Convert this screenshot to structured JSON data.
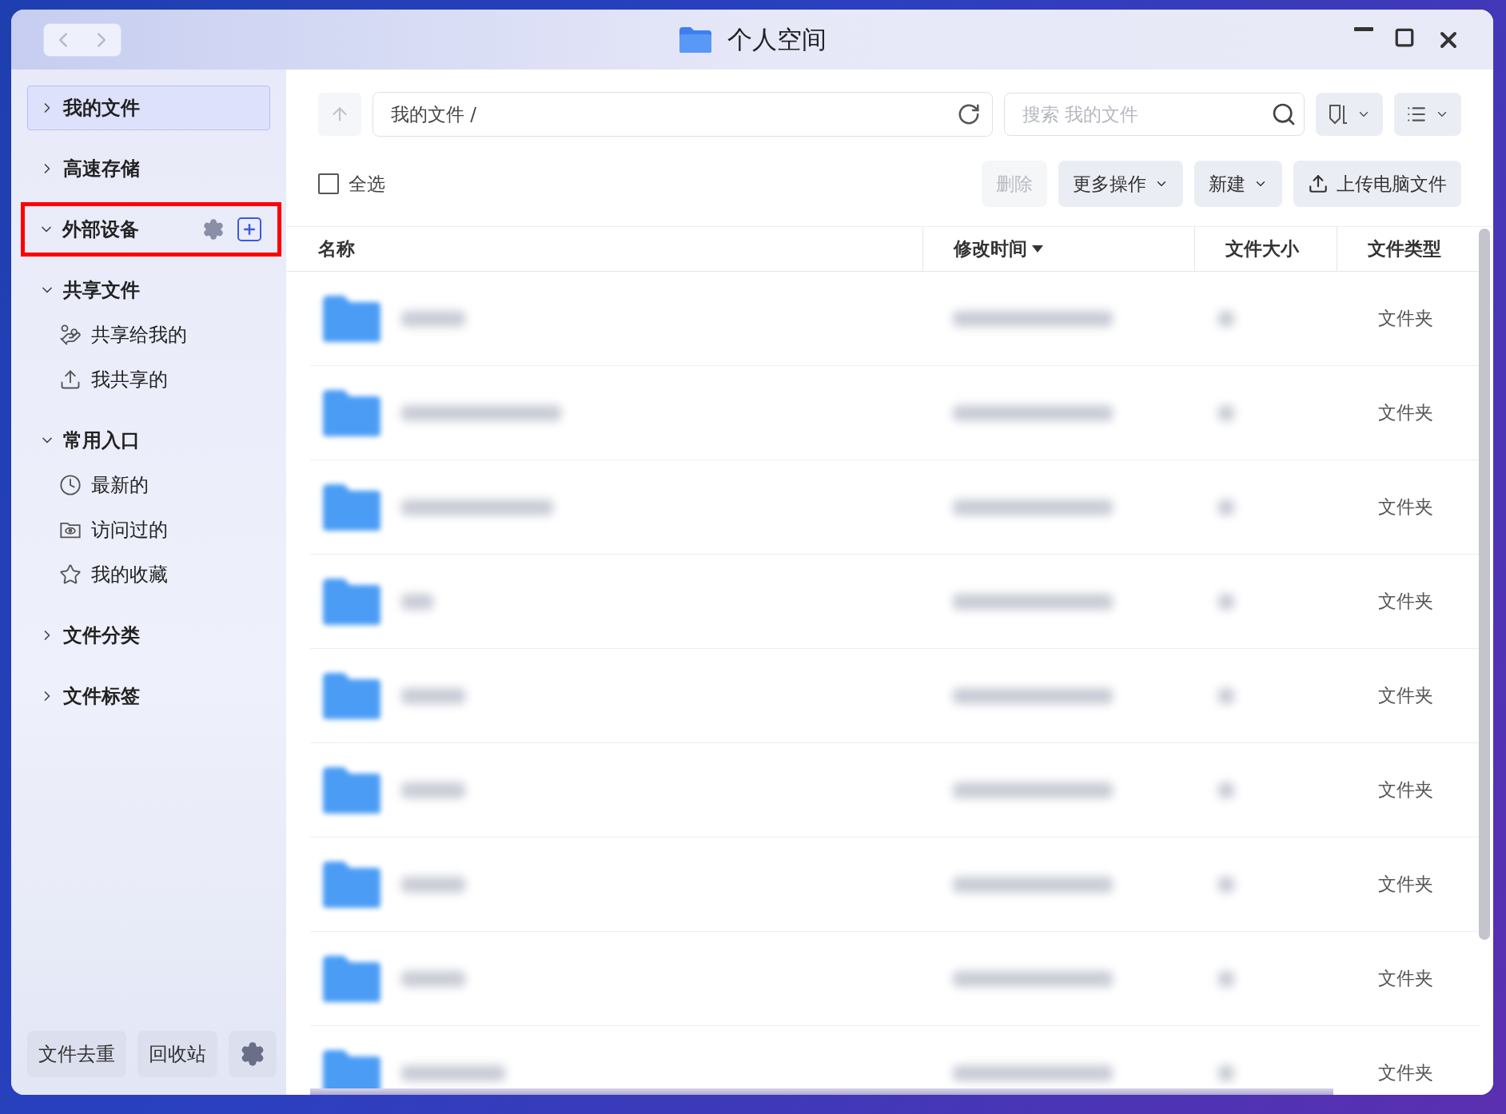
{
  "window": {
    "title": "个人空间"
  },
  "sidebar": {
    "items": [
      {
        "label": "我的文件",
        "expanded": false,
        "selected": true,
        "highlighted": false
      },
      {
        "label": "高速存储",
        "expanded": false,
        "selected": false,
        "highlighted": false
      },
      {
        "label": "外部设备",
        "expanded": true,
        "selected": false,
        "highlighted": true
      },
      {
        "label": "共享文件",
        "expanded": true,
        "selected": false,
        "highlighted": false,
        "children": [
          {
            "label": "共享给我的",
            "selected": false
          },
          {
            "label": "我共享的",
            "selected": false
          }
        ]
      },
      {
        "label": "常用入口",
        "expanded": true,
        "selected": false,
        "highlighted": false,
        "children": [
          {
            "label": "最新的",
            "selected": false
          },
          {
            "label": "访问过的",
            "selected": false
          },
          {
            "label": "我的收藏",
            "selected": false
          }
        ]
      },
      {
        "label": "文件分类",
        "expanded": false,
        "selected": false,
        "highlighted": false
      },
      {
        "label": "文件标签",
        "expanded": false,
        "selected": false,
        "highlighted": false
      }
    ],
    "footer_buttons": [
      "文件去重",
      "回收站"
    ]
  },
  "path": {
    "value": "我的文件 /"
  },
  "search": {
    "placeholder": "搜索 我的文件"
  },
  "select_all": {
    "label": "全选",
    "checked": false
  },
  "actions": [
    {
      "label": "删除",
      "disabled": true,
      "kind": "plain"
    },
    {
      "label": "更多操作",
      "disabled": false,
      "kind": "dropdown"
    },
    {
      "label": "新建",
      "disabled": false,
      "kind": "dropdown"
    },
    {
      "label": "上传电脑文件",
      "disabled": false,
      "kind": "upload"
    }
  ],
  "table": {
    "columns": [
      {
        "label": "名称",
        "sorted": false
      },
      {
        "label": "修改时间",
        "sorted": true
      },
      {
        "label": "文件大小",
        "sorted": false
      },
      {
        "label": "文件类型",
        "sorted": false
      }
    ],
    "rows": [
      {
        "type": "文件夹"
      },
      {
        "type": "文件夹"
      },
      {
        "type": "文件夹"
      },
      {
        "type": "文件夹"
      },
      {
        "type": "文件夹"
      },
      {
        "type": "文件夹"
      },
      {
        "type": "文件夹"
      },
      {
        "type": "文件夹"
      },
      {
        "type": "文件夹"
      }
    ]
  }
}
